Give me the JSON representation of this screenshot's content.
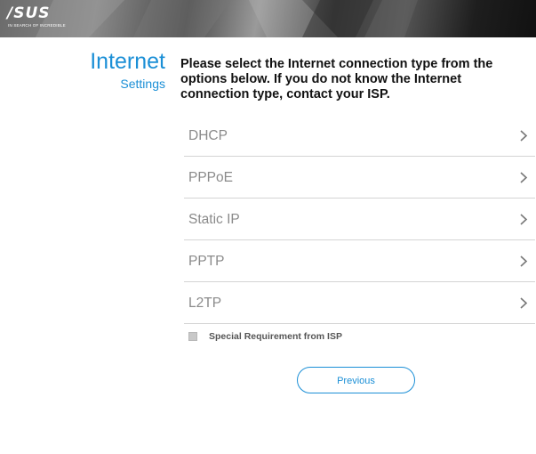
{
  "header": {
    "logo_text": "/SUS",
    "logo_tagline": "IN SEARCH OF INCREDIBLE"
  },
  "sidebar": {
    "title": "Internet",
    "subtitle": "Settings"
  },
  "instructions": "Please select the Internet connection type from the options below. If you do not know the Internet connection type, contact your ISP.",
  "options": [
    {
      "label": "DHCP",
      "icon": "chevron-right-icon"
    },
    {
      "label": "PPPoE",
      "icon": "chevron-right-icon"
    },
    {
      "label": "Static IP",
      "icon": "chevron-right-icon"
    },
    {
      "label": "PPTP",
      "icon": "chevron-right-icon"
    },
    {
      "label": "L2TP",
      "icon": "chevron-right-icon"
    }
  ],
  "special_requirement": {
    "label": "Special Requirement from ISP",
    "checked": false
  },
  "previous_button": {
    "label": "Previous"
  },
  "colors": {
    "accent": "#1b8fd6",
    "option_text": "#8a8a8a",
    "divider": "#d4d4d4"
  }
}
